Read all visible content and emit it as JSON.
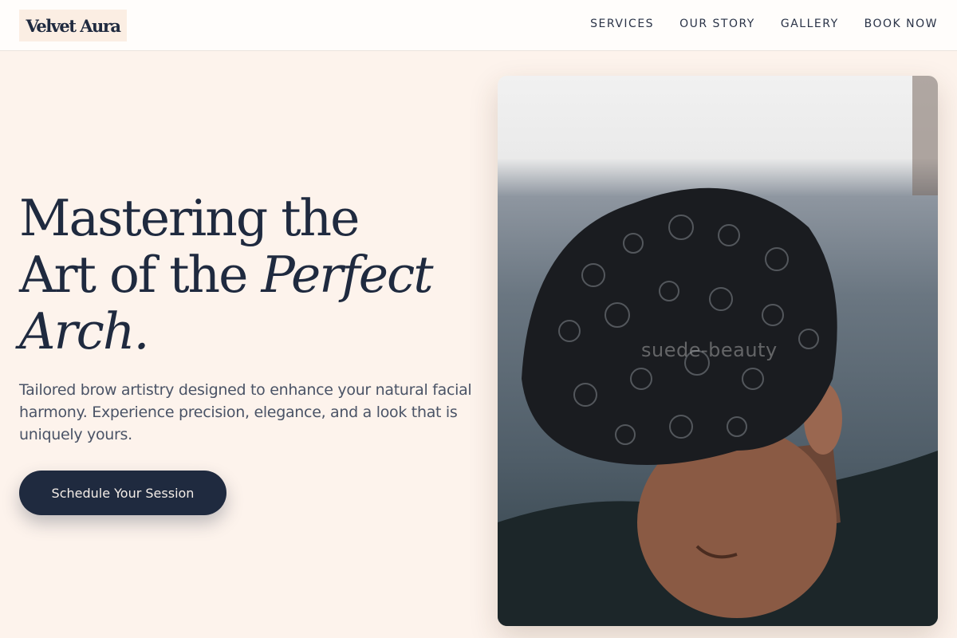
{
  "header": {
    "logo_text": "Velvet Aura",
    "nav": [
      {
        "label": "SERVICES"
      },
      {
        "label": "OUR STORY"
      },
      {
        "label": "GALLERY"
      },
      {
        "label": "BOOK NOW"
      }
    ]
  },
  "hero": {
    "title_line1": "Mastering the",
    "title_line2_plain": "Art of the ",
    "title_line2_italic": "Perfect",
    "title_line3_italic": "Arch.",
    "description": "Tailored brow artistry designed to enhance your natural facial harmony. Experience precision, elegance, and a look that is uniquely yours.",
    "cta_label": "Schedule Your Session"
  },
  "photo": {
    "watermark": "suede-beauty"
  },
  "colors": {
    "background": "#fdf3ec",
    "navy": "#1f2a3f",
    "logo_bg": "#fbeee3"
  }
}
